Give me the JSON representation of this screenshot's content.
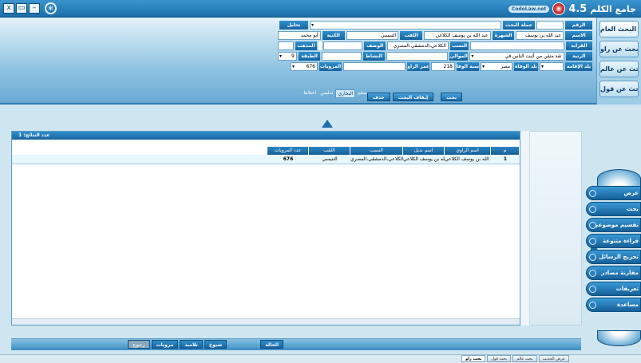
{
  "window": {
    "title": "جامع الكلم",
    "version": "4.5",
    "brand": "CodeLaw.net",
    "controls": [
      "x",
      "▭",
      "–"
    ]
  },
  "sidebar": {
    "items": [
      {
        "label": "البحث العام"
      },
      {
        "label": "بحث عن راو"
      },
      {
        "label": "بحث عن عالم"
      },
      {
        "label": "بحث عن قول"
      }
    ]
  },
  "form": {
    "row1": {
      "number_label": "الرقم",
      "number_value": "",
      "phrase_label": "جملة البحث",
      "phrase_value": "",
      "analyze_label": "تحليل"
    },
    "row2": {
      "name_label": "الاسم",
      "name_value": "عبد الله بن يوسف",
      "fame_label": "الشهرة",
      "fame_value": "عبد الله بن يوسف الكلاعي",
      "title_label": "اللقب",
      "title_value": "التنيسي",
      "kunya_label": "الكنية",
      "kunya_value": "أبو محمد"
    },
    "row3": {
      "relation_label": "القرابة",
      "relation_value": "",
      "lineage_label": "النسب",
      "lineage_value": "الكلاعي،الدمشقي،المصري",
      "desc_label": "الوصف",
      "desc_value": "",
      "madhhab_label": "المذهب",
      "madhhab_value": ""
    },
    "row4": {
      "rank_label": "الرتبة",
      "rank_value": "ثقة متقن من أثبت الناس في",
      "allies_label": "الموالي",
      "allies_value": "",
      "activity_label": "النشاط",
      "activity_value": "",
      "tabaqa_label": "الطبقة",
      "tabaqa_value": "9"
    },
    "row5": {
      "residence_label": "بلد الإقامة",
      "residence_value": "",
      "death_country_label": "بلد الوفاة",
      "death_country_value": "مصر",
      "death_year_label": "سنة الوفاة",
      "death_year_value": "218",
      "age_label": "عمر الراوي",
      "age_value": "",
      "narrations_label": "المرويات",
      "narrations_value": "676"
    }
  },
  "tabs": {
    "muslim": "مسلم",
    "bukhari": "البخاري",
    "tadlis": "تدليس",
    "ikhtilat": "اختلاط"
  },
  "actions": {
    "search": "بحث",
    "stop": "إيقاف البحث",
    "delete": "حذف"
  },
  "results": {
    "count_label": "عدد النتائج:",
    "count_value": "1",
    "columns": [
      "م",
      "اسم الراوي",
      "اسم بديل",
      "النسب",
      "اللقب",
      "عدد المرويات"
    ],
    "rows": [
      {
        "idx": "1",
        "name": "عبد الله بن يوسف الكلاعي",
        "alt": "عبد الله بن يوسف الكلاعي",
        "lineage": "الكلاعي،الدمشقي،المصري",
        "title": "التنيسي",
        "count": "676"
      }
    ]
  },
  "right_menu": {
    "items": [
      {
        "label": "عرض"
      },
      {
        "label": "بحث"
      },
      {
        "label": "تقسيم موضوعي"
      },
      {
        "label": "قراءة متنوعة"
      },
      {
        "label": "تخريج الرسائل"
      },
      {
        "label": "مقارنة مصادر"
      },
      {
        "label": "تعريفات"
      },
      {
        "label": "مساعدة"
      }
    ]
  },
  "bottom_tabs": {
    "status": "الحالة",
    "sheikhs": "شيوخ",
    "students": "تلاميذ",
    "narrations": "مرويات",
    "back": "رجوع"
  },
  "status_tabs": {
    "narrator": "بحث راو",
    "scholar": "بحث عالم",
    "saying": "بحث قول",
    "hadith": "عرض الحديث"
  }
}
